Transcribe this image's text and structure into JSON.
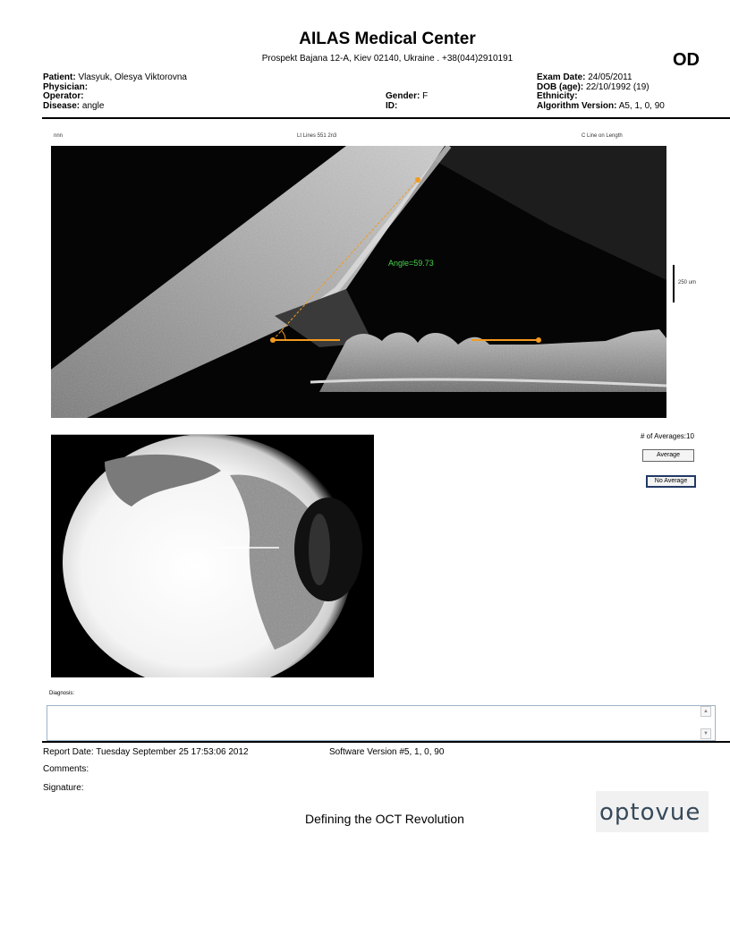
{
  "header": {
    "center_name": "AILAS Medical Center",
    "address": "Prospekt Bajana 12-A, Kiev 02140, Ukraine . +38(044)2910191",
    "eye": "OD"
  },
  "patient_info": {
    "patient_label": "Patient:",
    "patient_value": "Vlasyuk, Olesya Viktorovna",
    "physician_label": "Physician:",
    "physician_value": "",
    "operator_label": "Operator:",
    "operator_value": "",
    "disease_label": "Disease:",
    "disease_value": "angle",
    "gender_label": "Gender:",
    "gender_value": "F",
    "id_label": "ID:",
    "id_value": "",
    "exam_date_label": "Exam Date:",
    "exam_date_value": "24/05/2011",
    "dob_label": "DOB (age):",
    "dob_value": "22/10/1992 (19)",
    "ethnicity_label": "Ethnicity:",
    "ethnicity_value": "",
    "algorithm_label": "Algorithm Version:",
    "algorithm_value": "A5, 1, 0, 90"
  },
  "scan": {
    "left_tag": "nnn",
    "center_tag": "Lt Lines   551   2n3",
    "right_tag": "C Line  on Length",
    "angle_label": "Angle=59.73",
    "scale_label": "250 um"
  },
  "controls": {
    "averages_label": "# of Averages:10",
    "average_button": "Average",
    "no_average_button": "No Average"
  },
  "diagnosis": {
    "label": "Diagnosis:",
    "text": ""
  },
  "footer": {
    "report_date": "Report Date: Tuesday September 25 17:53:06 2012",
    "software_version": "Software Version #5, 1, 0, 90",
    "comments_label": "Comments:",
    "signature_label": "Signature:",
    "slogan": "Defining the OCT Revolution",
    "logo_text": "optovue"
  },
  "colors": {
    "measure": "#f39a1f",
    "angle_text": "#47d44a",
    "scrollbar_border": "#9db3c8"
  }
}
